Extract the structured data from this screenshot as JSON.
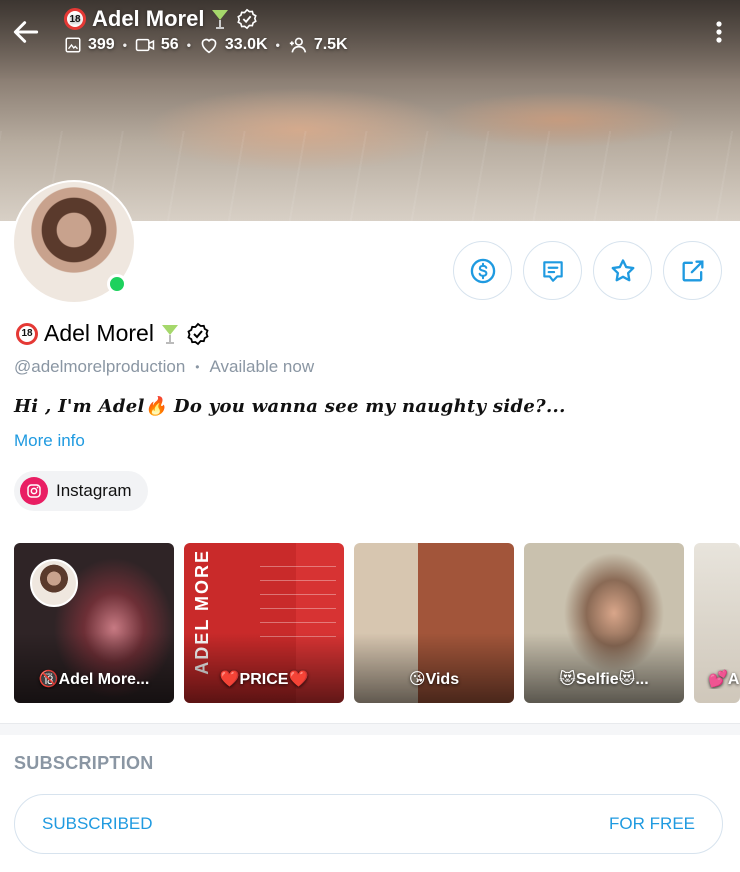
{
  "header": {
    "title": "Adel Morel",
    "stats": {
      "photos": "399",
      "videos": "56",
      "likes": "33.0K",
      "fans": "7.5K"
    }
  },
  "profile": {
    "name": "Adel Morel",
    "handle": "@adelmorelproduction",
    "status": "Available now",
    "bio": "Hi , I'm Adel🔥 Do you wanna see my naughty side?...",
    "more_info": "More info",
    "social": {
      "label": "Instagram"
    }
  },
  "highlights": [
    {
      "label": "🔞Adel More..."
    },
    {
      "label": "❤️PRICE❤️",
      "side_text": "ADEL MORE"
    },
    {
      "label": "😘Vids"
    },
    {
      "label": "😻Selfie😻..."
    },
    {
      "label": "💕A"
    }
  ],
  "subscription": {
    "section_title": "SUBSCRIPTION",
    "status_label": "SUBSCRIBED",
    "price_label": "FOR FREE"
  },
  "colors": {
    "accent": "#1f9ae0",
    "muted": "#8a96a3",
    "online": "#1dd15d",
    "instagram": "#e91e63"
  },
  "icons": [
    "back-arrow-icon",
    "more-vert-icon",
    "adult-18-icon",
    "cocktail-icon",
    "verified-icon",
    "photo-icon",
    "video-icon",
    "heart-icon",
    "fans-icon",
    "dollar-icon",
    "message-icon",
    "star-icon",
    "share-icon",
    "instagram-icon"
  ]
}
